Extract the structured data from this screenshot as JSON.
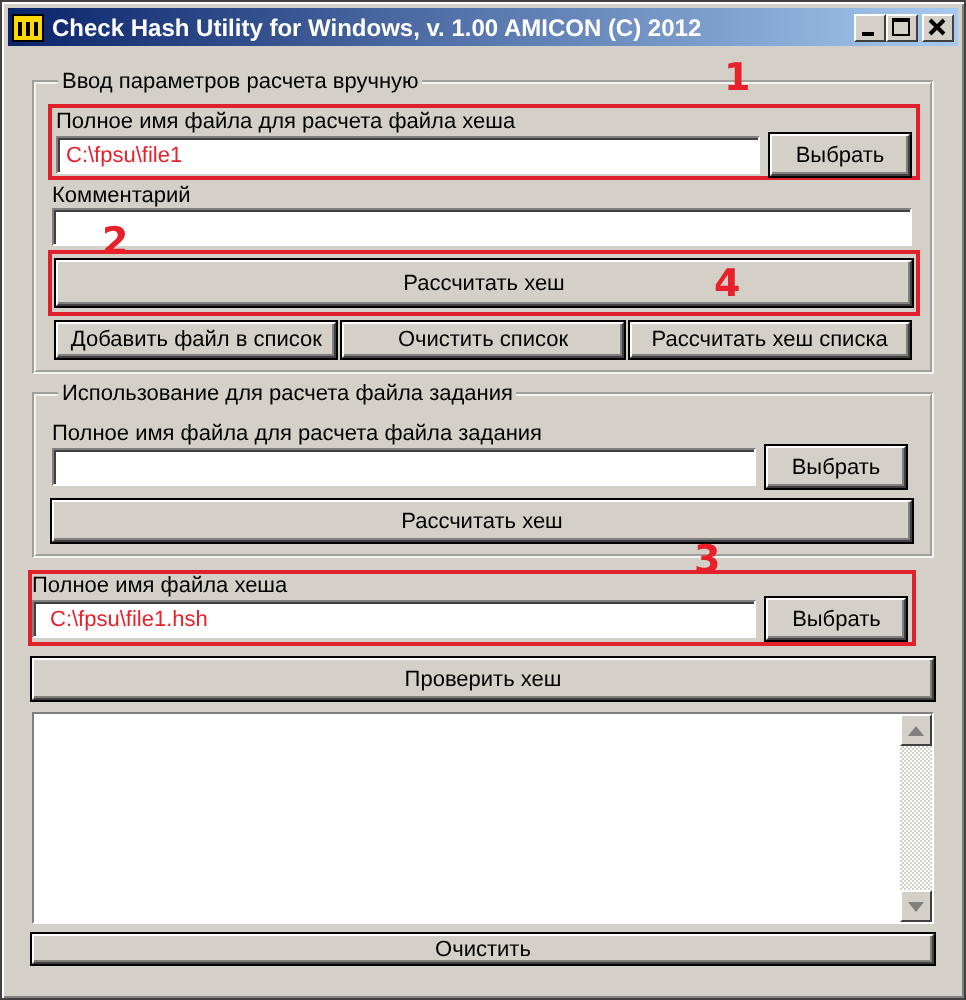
{
  "window": {
    "title": "Check Hash Utility for Windows, v. 1.00 AMICON (C) 2012"
  },
  "manual": {
    "legend": "Ввод параметров расчета вручную",
    "file": {
      "callout": "1",
      "label": "Полное имя файла для расчета файла хеша",
      "value": "C:\\fpsu\\file1",
      "browse": "Выбрать"
    },
    "comment": {
      "callout": "2",
      "label": "Комментарий"
    },
    "calc": {
      "callout": "4",
      "label": "Рассчитать хеш"
    },
    "list_buttons": [
      "Добавить файл в список",
      "Очистить список",
      "Рассчитать хеш списка"
    ]
  },
  "task": {
    "legend": "Использование для расчета файла задания",
    "label": "Полное имя файла для расчета файла задания",
    "browse": "Выбрать",
    "calc": "Рассчитать хеш",
    "callout": "3"
  },
  "hash_file": {
    "label": "Полное имя файла хеша",
    "value": "C:\\fpsu\\file1.hsh",
    "browse": "Выбрать"
  },
  "verify_button": "Проверить хеш",
  "clear_button": "Очистить"
}
